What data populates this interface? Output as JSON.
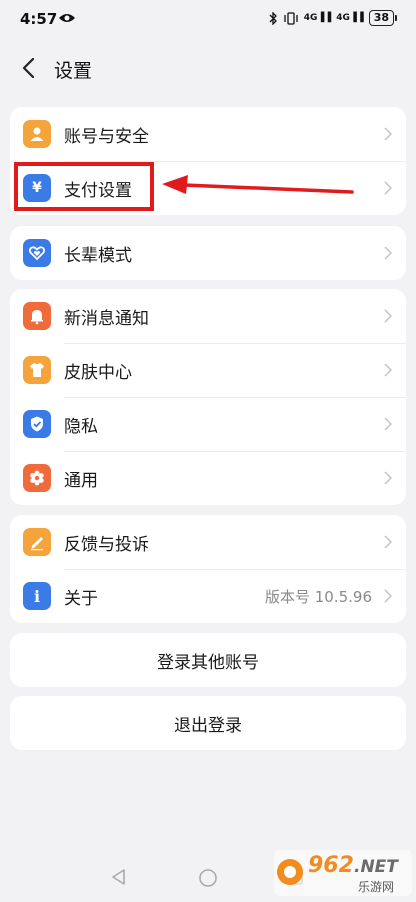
{
  "status_bar": {
    "time": "4:57",
    "signal1": "4G",
    "signal2": "4G",
    "battery": "38"
  },
  "header": {
    "title": "设置"
  },
  "groups": [
    {
      "items": [
        {
          "label": "账号与安全",
          "icon": "user-icon",
          "color": "#f5a33b"
        },
        {
          "label": "支付设置",
          "icon": "yuan-icon",
          "color": "#3a7be8"
        }
      ]
    },
    {
      "items": [
        {
          "label": "长辈模式",
          "icon": "heart-icon",
          "color": "#3a7be8"
        }
      ]
    },
    {
      "items": [
        {
          "label": "新消息通知",
          "icon": "bell-icon",
          "color": "#f06b3c"
        },
        {
          "label": "皮肤中心",
          "icon": "tshirt-icon",
          "color": "#f5a33b"
        },
        {
          "label": "隐私",
          "icon": "shield-icon",
          "color": "#3a7be8"
        },
        {
          "label": "通用",
          "icon": "gear-icon",
          "color": "#f06b3c"
        }
      ]
    },
    {
      "items": [
        {
          "label": "反馈与投诉",
          "icon": "pencil-icon",
          "color": "#f5a33b"
        },
        {
          "label": "关于",
          "icon": "info-icon",
          "color": "#3a7be8",
          "value": "版本号 10.5.96"
        }
      ]
    }
  ],
  "buttons": {
    "login_other": "登录其他账号",
    "logout": "退出登录"
  },
  "watermark": {
    "brand": "962",
    "suffix": ".NET",
    "sub": "乐游网"
  },
  "colors": {
    "highlight": "#e11b1b",
    "background": "#f2f2f4"
  }
}
